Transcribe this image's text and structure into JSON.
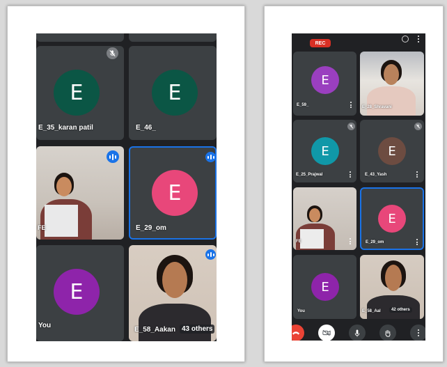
{
  "left_screen": {
    "tiles": [
      {
        "id": "karan",
        "name": "E_35_karan patil",
        "initial": "E",
        "color": "#0b5645",
        "muted": true
      },
      {
        "id": "e46",
        "name": "E_46_",
        "initial": "E",
        "color": "#0b5645"
      },
      {
        "id": "fe",
        "name": "FE",
        "speaking": true
      },
      {
        "id": "om",
        "name": "E_29_om",
        "initial": "E",
        "color": "#e8477a",
        "speaking": true,
        "active": true
      },
      {
        "id": "you",
        "name": "You",
        "initial": "E",
        "color": "#8e24aa"
      },
      {
        "id": "aakanksha",
        "name": "E_58_Aakan",
        "speaking": true
      }
    ],
    "others_label": "43 others"
  },
  "right_screen": {
    "rec_label": "REC",
    "tiles": [
      {
        "id": "e59",
        "name": "E_59_",
        "initial": "E",
        "color": "#9a3fbf"
      },
      {
        "id": "shravani",
        "name": "E_28_Shravani"
      },
      {
        "id": "prajwal",
        "name": "E_25_Prajwal",
        "initial": "E",
        "color": "#1098a8",
        "muted": true
      },
      {
        "id": "yash",
        "name": "E_43_Yash",
        "initial": "E",
        "color": "#6d4c41",
        "muted": true
      },
      {
        "id": "fe",
        "name": "FE"
      },
      {
        "id": "om",
        "name": "E_29_om",
        "initial": "E",
        "color": "#e8477a",
        "active": true
      },
      {
        "id": "you",
        "name": "You",
        "initial": "E",
        "color": "#8e24aa"
      },
      {
        "id": "aakanksha",
        "name": "E_58_Aal"
      }
    ],
    "others_label": "42 others",
    "controls": [
      "end-call",
      "camera-off",
      "mic",
      "raise-hand",
      "more"
    ]
  },
  "colors": {
    "screen_bg": "#202124",
    "tile_bg": "#3c4043",
    "active_border": "#1a73e8",
    "rec_red": "#d93025",
    "end_call_red": "#ea4335"
  }
}
